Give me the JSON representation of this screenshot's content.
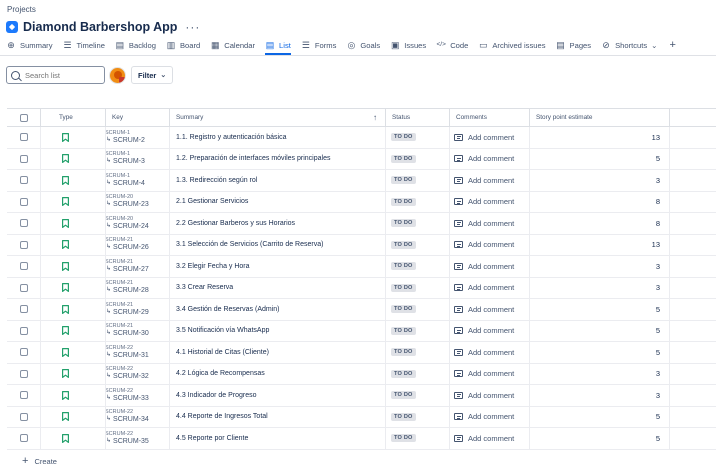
{
  "breadcrumb": "Projects",
  "project": {
    "title": "Diamond Barbershop App",
    "more": "···",
    "icon": "project-icon"
  },
  "nav": [
    {
      "label": "Summary",
      "icon": "globe-icon",
      "glyph": "⊕"
    },
    {
      "label": "Timeline",
      "icon": "timeline-icon",
      "glyph": "☰"
    },
    {
      "label": "Backlog",
      "icon": "backlog-icon",
      "glyph": "▤"
    },
    {
      "label": "Board",
      "icon": "board-icon",
      "glyph": "▥"
    },
    {
      "label": "Calendar",
      "icon": "calendar-icon",
      "glyph": "▦"
    },
    {
      "label": "List",
      "icon": "list-icon",
      "glyph": "▤",
      "active": true
    },
    {
      "label": "Forms",
      "icon": "forms-icon",
      "glyph": "☰"
    },
    {
      "label": "Goals",
      "icon": "goals-icon",
      "glyph": "◎"
    },
    {
      "label": "Issues",
      "icon": "issues-icon",
      "glyph": "▣"
    },
    {
      "label": "Code",
      "icon": "code-icon",
      "glyph": "</>"
    },
    {
      "label": "Archived issues",
      "icon": "archive-icon",
      "glyph": "▭"
    },
    {
      "label": "Pages",
      "icon": "pages-icon",
      "glyph": "▤"
    },
    {
      "label": "Shortcuts",
      "icon": "link-icon",
      "glyph": "⊘",
      "chevron": "⌄"
    }
  ],
  "nav_add": "+",
  "toolbar": {
    "search_placeholder": "Search list",
    "filter_label": "Filter",
    "filter_chevron": "⌄"
  },
  "columns": {
    "type": "Type",
    "key": "Key",
    "summary": "Summary",
    "sort": "↑",
    "status": "Status",
    "comments": "Comments",
    "estimate": "Story point estimate"
  },
  "rows": [
    {
      "parent": "SCRUM-1",
      "key": "SCRUM-2",
      "summary": "1.1. Registro y autenticación básica",
      "status": "TO DO",
      "comment": "Add comment",
      "estimate": "13"
    },
    {
      "parent": "SCRUM-1",
      "key": "SCRUM-3",
      "summary": "1.2. Preparación de interfaces móviles principales",
      "status": "TO DO",
      "comment": "Add comment",
      "estimate": "5"
    },
    {
      "parent": "SCRUM-1",
      "key": "SCRUM-4",
      "summary": "1.3. Redirección según rol",
      "status": "TO DO",
      "comment": "Add comment",
      "estimate": "3"
    },
    {
      "parent": "SCRUM-20",
      "key": "SCRUM-23",
      "summary": "2.1 Gestionar Servicios",
      "status": "TO DO",
      "comment": "Add comment",
      "estimate": "8"
    },
    {
      "parent": "SCRUM-20",
      "key": "SCRUM-24",
      "summary": "2.2 Gestionar Barberos y sus Horarios",
      "status": "TO DO",
      "comment": "Add comment",
      "estimate": "8"
    },
    {
      "parent": "SCRUM-21",
      "key": "SCRUM-26",
      "summary": "3.1 Selección de Servicios (Carrito de Reserva)",
      "status": "TO DO",
      "comment": "Add comment",
      "estimate": "13"
    },
    {
      "parent": "SCRUM-21",
      "key": "SCRUM-27",
      "summary": "3.2 Elegir Fecha y Hora",
      "status": "TO DO",
      "comment": "Add comment",
      "estimate": "3"
    },
    {
      "parent": "SCRUM-21",
      "key": "SCRUM-28",
      "summary": "3.3 Crear Reserva",
      "status": "TO DO",
      "comment": "Add comment",
      "estimate": "3"
    },
    {
      "parent": "SCRUM-21",
      "key": "SCRUM-29",
      "summary": "3.4 Gestión de Reservas (Admin)",
      "status": "TO DO",
      "comment": "Add comment",
      "estimate": "5"
    },
    {
      "parent": "SCRUM-21",
      "key": "SCRUM-30",
      "summary": "3.5 Notificación vía WhatsApp",
      "status": "TO DO",
      "comment": "Add comment",
      "estimate": "5"
    },
    {
      "parent": "SCRUM-22",
      "key": "SCRUM-31",
      "summary": "4.1 Historial de Citas (Cliente)",
      "status": "TO DO",
      "comment": "Add comment",
      "estimate": "5"
    },
    {
      "parent": "SCRUM-22",
      "key": "SCRUM-32",
      "summary": "4.2 Lógica de Recompensas",
      "status": "TO DO",
      "comment": "Add comment",
      "estimate": "3"
    },
    {
      "parent": "SCRUM-22",
      "key": "SCRUM-33",
      "summary": "4.3 Indicador de Progreso",
      "status": "TO DO",
      "comment": "Add comment",
      "estimate": "3"
    },
    {
      "parent": "SCRUM-22",
      "key": "SCRUM-34",
      "summary": "4.4 Reporte de Ingresos Total",
      "status": "TO DO",
      "comment": "Add comment",
      "estimate": "5"
    },
    {
      "parent": "SCRUM-22",
      "key": "SCRUM-35",
      "summary": "4.5 Reporte por Cliente",
      "status": "TO DO",
      "comment": "Add comment",
      "estimate": "5"
    }
  ],
  "create_label": "Create",
  "colors": {
    "accent": "#0c66e4",
    "story": "#22a06b",
    "lozenge_bg": "#dfe1e6"
  }
}
